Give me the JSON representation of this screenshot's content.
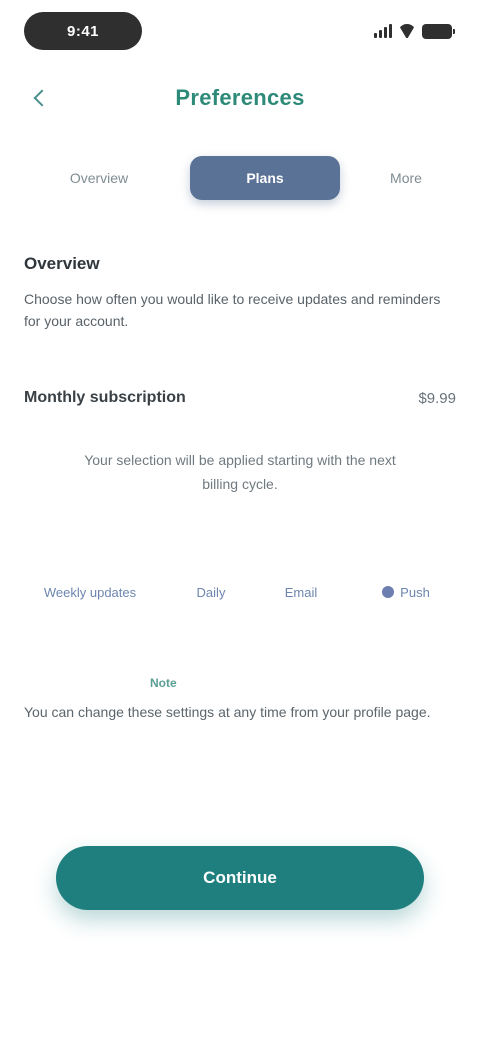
{
  "status_bar": {
    "time": "9:41"
  },
  "header": {
    "title": "Preferences"
  },
  "tabs": [
    {
      "label": "Overview"
    },
    {
      "label": "Plans"
    },
    {
      "label": "More"
    }
  ],
  "description": {
    "title": "Overview",
    "body": "Choose how often you would like to receive updates and reminders for your account."
  },
  "summary": {
    "label": "Monthly subscription",
    "value": "$9.99"
  },
  "center_text": "Your selection will be applied starting with the next billing cycle.",
  "chips": [
    {
      "label": "Weekly updates"
    },
    {
      "label": "Daily"
    },
    {
      "label": "Email"
    },
    {
      "label": "Push"
    }
  ],
  "note": {
    "tag": "Note",
    "body": "You can change these settings at any time from your profile page."
  },
  "cta": {
    "label": "Continue"
  },
  "colors": {
    "accent": "#1f7f7f",
    "tab_active": "#5a7296",
    "title": "#2e8a78"
  }
}
